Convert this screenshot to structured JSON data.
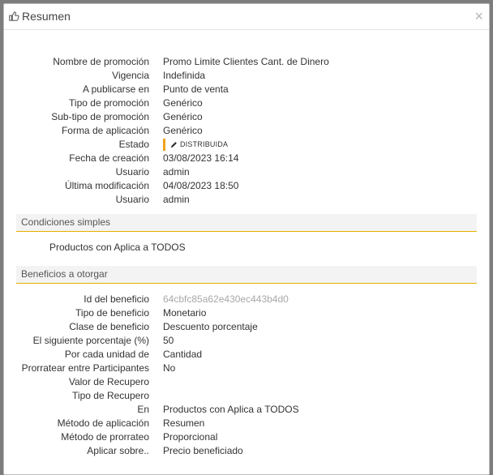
{
  "dialog": {
    "title": "Resumen",
    "close_glyph": "×",
    "title_icon": "thumbs-up-icon"
  },
  "summary": [
    {
      "label": "Nombre de promoción",
      "value": "Promo Limite Clientes Cant. de Dinero"
    },
    {
      "label": "Vigencia",
      "value": "Indefinida"
    },
    {
      "label": "A publicarse en",
      "value": "Punto de venta"
    },
    {
      "label": "Tipo de promoción",
      "value": "Genérico"
    },
    {
      "label": "Sub-tipo de promoción",
      "value": "Genérico"
    },
    {
      "label": "Forma de aplicación",
      "value": "Genérico"
    },
    {
      "label": "Estado",
      "value": "DISTRIBUIDA",
      "badge": true,
      "badge_color": "#f0a21b",
      "icon": "pencil-icon"
    },
    {
      "label": "Fecha de creación",
      "value": "03/08/2023 16:14"
    },
    {
      "label": "Usuario",
      "value": "admin"
    },
    {
      "label": "Última modificación",
      "value": "04/08/2023 18:50"
    },
    {
      "label": "Usuario",
      "value": "admin"
    }
  ],
  "conditions": {
    "header": "Condiciones simples",
    "items": [
      "Productos con Aplica a TODOS"
    ]
  },
  "benefits": {
    "header": "Beneficios a otorgar",
    "rows": [
      {
        "label": "Id del beneficio",
        "value": "64cbfc85a62e430ec443b4d0",
        "muted": true
      },
      {
        "label": "Tipo de beneficio",
        "value": "Monetario"
      },
      {
        "label": "Clase de beneficio",
        "value": "Descuento porcentaje"
      },
      {
        "label": "El siguiente porcentaje (%)",
        "value": "50"
      },
      {
        "label": "Por cada unidad de",
        "value": "Cantidad"
      },
      {
        "label": "Prorratear entre Participantes",
        "value": "No"
      },
      {
        "label": "Valor de Recupero",
        "value": ""
      },
      {
        "label": "Tipo de Recupero",
        "value": ""
      },
      {
        "label": "En",
        "value": "Productos con Aplica a TODOS"
      },
      {
        "label": "Método de aplicación",
        "value": "Resumen"
      },
      {
        "label": "Método de prorrateo",
        "value": "Proporcional"
      },
      {
        "label": "Aplicar sobre..",
        "value": "Precio beneficiado"
      }
    ]
  },
  "colors": {
    "section_rule": "#e3b200",
    "badge_accent": "#f0a21b"
  }
}
